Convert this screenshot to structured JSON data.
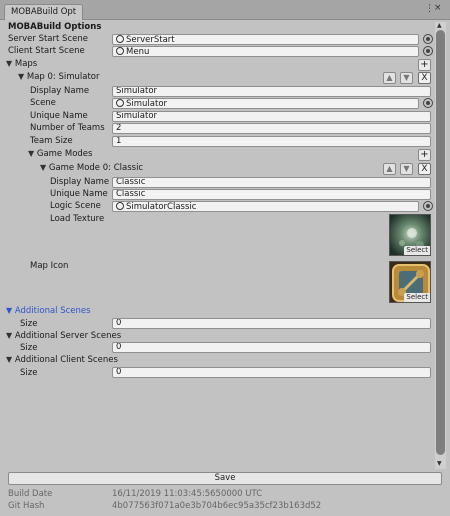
{
  "window": {
    "tab_title": "MOBABuild Opt",
    "menu_glyph": "⋮",
    "close_glyph": "×"
  },
  "header": {
    "title": "MOBABuild Options"
  },
  "server_start_scene": {
    "label": "Server Start Scene",
    "value": "ServerStart"
  },
  "client_start_scene": {
    "label": "Client Start Scene",
    "value": "Menu"
  },
  "maps": {
    "label": "Maps",
    "map0": {
      "header": "Map 0: Simulator",
      "display_name": {
        "label": "Display Name",
        "value": "Simulator"
      },
      "scene": {
        "label": "Scene",
        "value": "Simulator"
      },
      "unique_name": {
        "label": "Unique Name",
        "value": "Simulator"
      },
      "number_of_teams": {
        "label": "Number of Teams",
        "value": "2"
      },
      "team_size": {
        "label": "Team Size",
        "value": "1"
      },
      "game_modes": {
        "label": "Game Modes",
        "mode0": {
          "header": "Game Mode 0: Classic",
          "display_name": {
            "label": "Display Name",
            "value": "Classic"
          },
          "unique_name": {
            "label": "Unique Name",
            "value": "Classic"
          },
          "logic_scene": {
            "label": "Logic Scene",
            "value": "SimulatorClassic"
          },
          "load_texture": {
            "label": "Load Texture"
          }
        }
      },
      "map_icon": {
        "label": "Map Icon"
      }
    }
  },
  "additional_scenes": {
    "label": "Additional Scenes",
    "size_label": "Size",
    "size_value": "0"
  },
  "additional_server_scenes": {
    "label": "Additional Server Scenes",
    "size_label": "Size",
    "size_value": "0"
  },
  "additional_client_scenes": {
    "label": "Additional Client Scenes",
    "size_label": "Size",
    "size_value": "0"
  },
  "buttons": {
    "save": "Save",
    "select": "Select",
    "add": "+",
    "up": "▲",
    "down": "▼",
    "remove": "X"
  },
  "info": {
    "build_date_label": "Build Date",
    "build_date_value": "16/11/2019 11:03:45:5650000 UTC",
    "git_hash_label": "Git Hash",
    "git_hash_value": "4b077563f071a0e3b704b6ec95a35cf23b163d52"
  },
  "icons": {
    "expanded_arrow": "▼",
    "object_icon": "scene-asset-icon",
    "picker_icon": "object-picker-icon"
  },
  "colors": {
    "selected_label": "#2f55c8",
    "panel_bg": "#c2c2c2"
  }
}
